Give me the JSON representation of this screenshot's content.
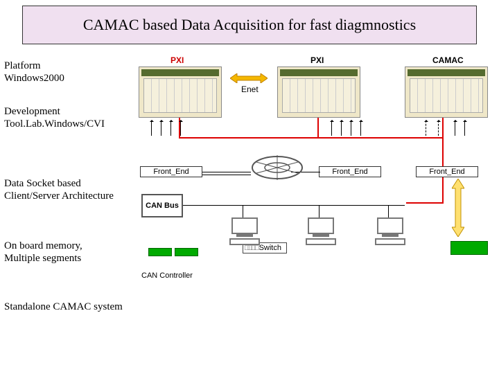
{
  "title": "CAMAC based Data Acquisition for fast diagmnostics",
  "bullets": {
    "platform": "Platform Windows2000",
    "devtool": "Development Tool.Lab.Windows/CVI",
    "datasocket": "Data Socket based Client/Server Architecture",
    "memory": "On board memory, Multiple segments",
    "standalone": "Standalone CAMAC system"
  },
  "diagram": {
    "pxi1": "PXI",
    "pxi2": "PXI",
    "camac": "CAMAC",
    "enet": "Enet",
    "frontend": "Front_End",
    "canbus": "CAN Bus",
    "switch": "Switch",
    "cancontroller": "CAN Controller"
  }
}
